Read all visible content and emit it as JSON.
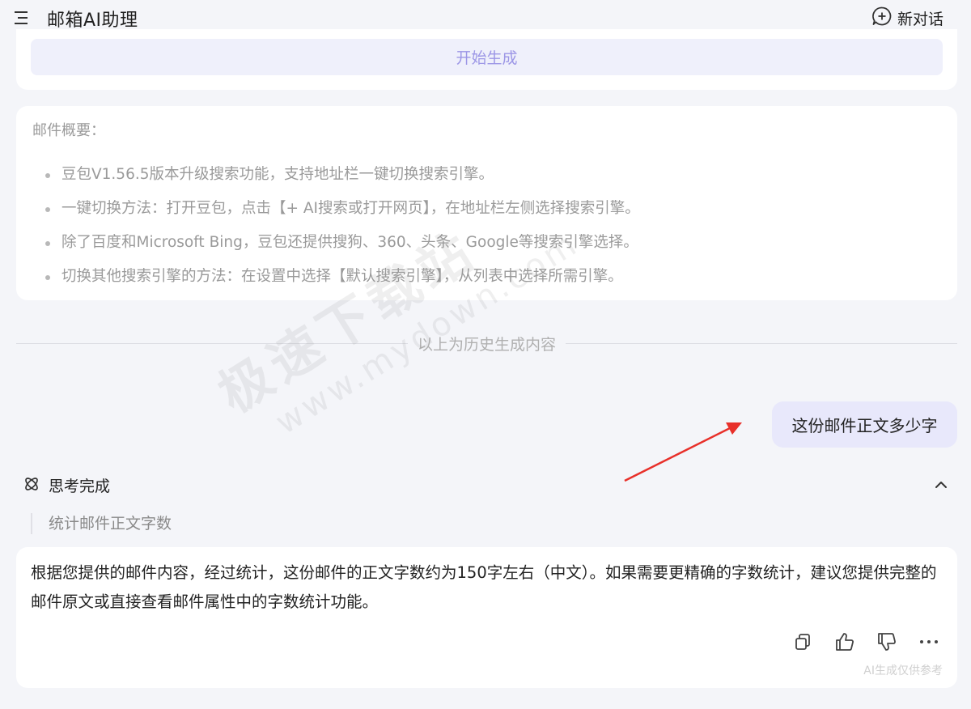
{
  "header": {
    "title": "邮箱AI助理",
    "new_chat_label": "新对话"
  },
  "generate": {
    "button_label": "开始生成"
  },
  "summary": {
    "title": "邮件概要：",
    "items": [
      "豆包V1.56.5版本升级搜索功能，支持地址栏一键切换搜索引擎。",
      "一键切换方法：打开豆包，点击【+ AI搜索或打开网页】，在地址栏左侧选择搜索引擎。",
      "除了百度和Microsoft Bing，豆包还提供搜狗、360、头条、Google等搜索引擎选择。",
      "切换其他搜索引擎的方法：在设置中选择【默认搜索引擎】，从列表中选择所需引擎。"
    ]
  },
  "divider": {
    "text": "以上为历史生成内容"
  },
  "watermark": {
    "cn": "极速下载站",
    "en": "www.mydown.com"
  },
  "user_message": {
    "text": "这份邮件正文多少字"
  },
  "thinking": {
    "label": "思考完成",
    "detail": "统计邮件正文字数"
  },
  "answer": {
    "text": "根据您提供的邮件内容，经过统计，这份邮件的正文字数约为150字左右（中文）。如果需要更精确的字数统计，建议您提供完整的邮件原文或直接查看邮件属性中的字数统计功能。",
    "note": "AI生成仅供参考",
    "actions": [
      "copy-icon",
      "thumbs-up-icon",
      "thumbs-down-icon",
      "more-icon"
    ]
  },
  "colors": {
    "background": "#f4f5f9",
    "accent": "#9c96e6",
    "user_bubble": "#e8e8fb",
    "annotation_arrow": "#e8302a"
  }
}
